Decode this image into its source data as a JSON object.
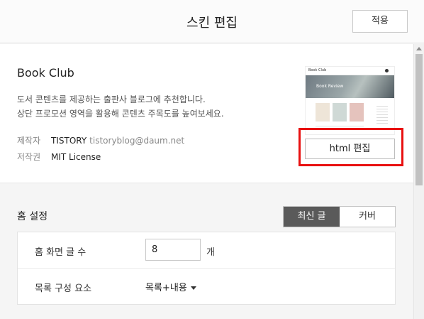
{
  "header": {
    "title": "스킨 편집",
    "apply_label": "적용"
  },
  "skin": {
    "name": "Book Club",
    "description": [
      "도서 콘텐츠를 제공하는 출판사 블로그에 추천합니다.",
      "상단 프로모션 영역을 활용해 콘텐츠 주목도를 높여보세요."
    ],
    "maker_label": "제작자",
    "maker": "TISTORY",
    "maker_email": "tistoryblog@daum.net",
    "license_label": "저작권",
    "license": "MIT License",
    "thumbnail": {
      "logo": "Book Club",
      "hero_text": "Book Review"
    },
    "html_edit_label": "html 편집"
  },
  "home_settings": {
    "title": "홈 설정",
    "tabs": [
      "최신 글",
      "커버"
    ],
    "active_tab": "최신 글",
    "post_count_label": "홈 화면 글 수",
    "post_count_value": "8",
    "post_count_unit": "개",
    "composition_label": "목록 구성 요소",
    "composition_value": "목록+내용"
  },
  "colors": {
    "highlight": "#e81010",
    "active_tab_bg": "#5a5a5a"
  }
}
